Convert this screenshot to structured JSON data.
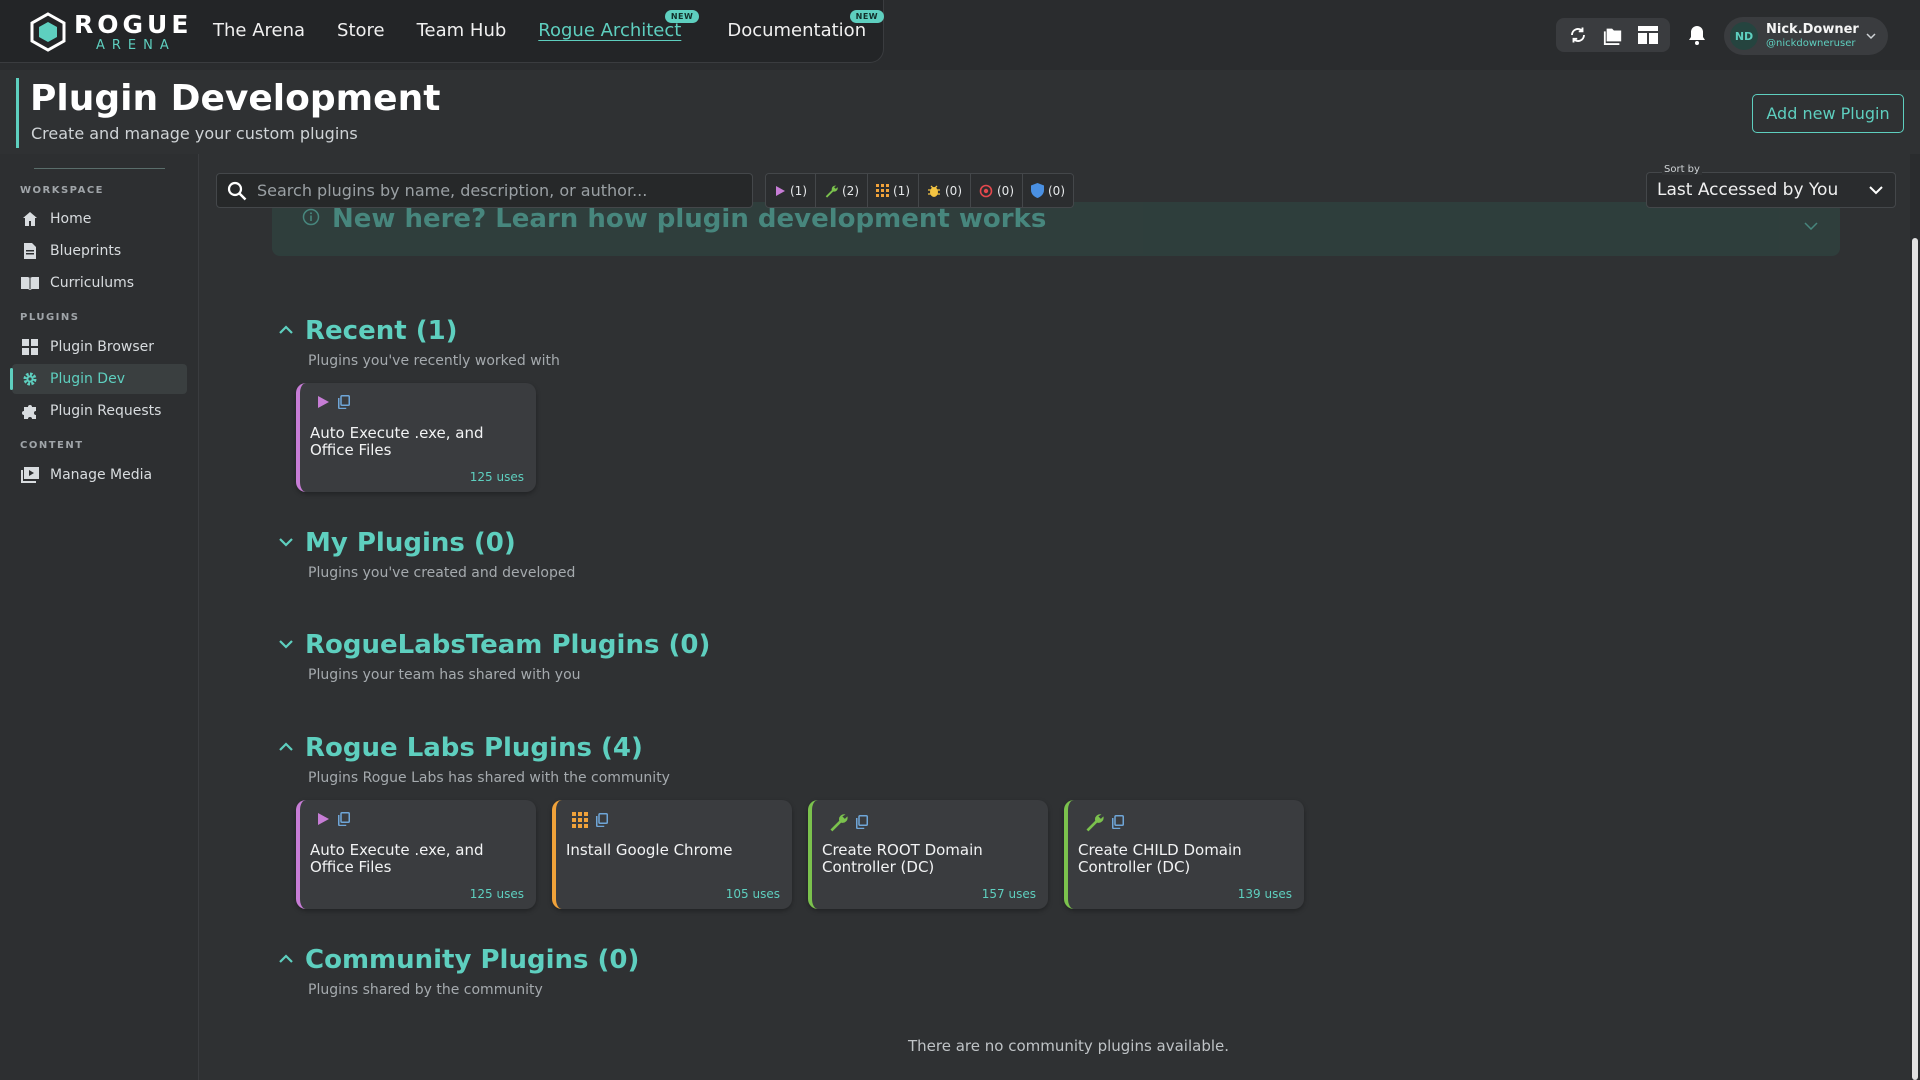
{
  "app": {
    "logo_main": "ROGUE",
    "logo_sub": "ARENA",
    "nav": [
      {
        "label": "The Arena",
        "badge": ""
      },
      {
        "label": "Store",
        "badge": ""
      },
      {
        "label": "Team Hub",
        "badge": ""
      },
      {
        "label": "Rogue Architect",
        "badge": "NEW",
        "active": true
      },
      {
        "label": "Documentation",
        "badge": "NEW"
      }
    ],
    "toolbar_icons": [
      "refresh-icon",
      "folder-icon",
      "layout-icon"
    ],
    "user": {
      "initials": "ND",
      "name": "Nick.Downer",
      "handle": "@nickdowneruser"
    }
  },
  "header": {
    "title": "Plugin Development",
    "subtitle": "Create and manage your custom plugins",
    "add_button": "Add new Plugin"
  },
  "sidebar": {
    "sections": [
      {
        "label": "WORKSPACE",
        "items": [
          {
            "label": "Home",
            "icon": "home-icon"
          },
          {
            "label": "Blueprints",
            "icon": "document-icon"
          },
          {
            "label": "Curriculums",
            "icon": "book-icon"
          }
        ]
      },
      {
        "label": "PLUGINS",
        "items": [
          {
            "label": "Plugin Browser",
            "icon": "grid-icon"
          },
          {
            "label": "Plugin Dev",
            "icon": "gear-icon",
            "active": true
          },
          {
            "label": "Plugin Requests",
            "icon": "puzzle-icon"
          }
        ]
      },
      {
        "label": "CONTENT",
        "items": [
          {
            "label": "Manage Media",
            "icon": "media-icon"
          }
        ]
      }
    ]
  },
  "toolbar": {
    "search_placeholder": "Search plugins by name, description, or author...",
    "filters": [
      {
        "icon": "play-icon",
        "count": "(1)",
        "color": "#c77dd6"
      },
      {
        "icon": "wrench-icon",
        "count": "(2)",
        "color": "#7bc24d"
      },
      {
        "icon": "grid-icon",
        "count": "(1)",
        "color": "#f0a23a"
      },
      {
        "icon": "bug-icon",
        "count": "(0)",
        "color": "#f5c542"
      },
      {
        "icon": "target-icon",
        "count": "(0)",
        "color": "#e5484d"
      },
      {
        "icon": "shield-icon",
        "count": "(0)",
        "color": "#4a90e2"
      }
    ],
    "sort_label": "Sort by",
    "sort_value": "Last Accessed by You"
  },
  "info_banner": "New here? Learn how plugin development works",
  "sections": [
    {
      "title": "Recent (1)",
      "desc": "Plugins you've recently worked with",
      "expanded": true
    },
    {
      "title": "My Plugins (0)",
      "desc": "Plugins you've created and developed",
      "expanded": false
    },
    {
      "title": "RogueLabsTeam Plugins (0)",
      "desc": "Plugins your team has shared with you",
      "expanded": false
    },
    {
      "title": "Rogue Labs Plugins (4)",
      "desc": "Plugins Rogue Labs has shared with the community",
      "expanded": true
    },
    {
      "title": "Community Plugins (0)",
      "desc": "Plugins shared by the community",
      "expanded": true
    }
  ],
  "recent_cards": [
    {
      "title": "Auto Execute .exe, and Office Files",
      "uses": "125 uses",
      "type": "play"
    }
  ],
  "roguelabs_cards": [
    {
      "title": "Auto Execute .exe, and Office Files",
      "uses": "125 uses",
      "type": "play"
    },
    {
      "title": "Install Google Chrome",
      "uses": "105 uses",
      "type": "grid"
    },
    {
      "title": "Create ROOT Domain Controller (DC)",
      "uses": "157 uses",
      "type": "wrench"
    },
    {
      "title": "Create CHILD Domain Controller (DC)",
      "uses": "139 uses",
      "type": "wrench"
    }
  ],
  "community_empty": "There are no community plugins available.",
  "colors": {
    "accent": "#5ecfbf",
    "play": "#c77dd6",
    "grid": "#f0a23a",
    "wrench": "#7bc24d"
  }
}
